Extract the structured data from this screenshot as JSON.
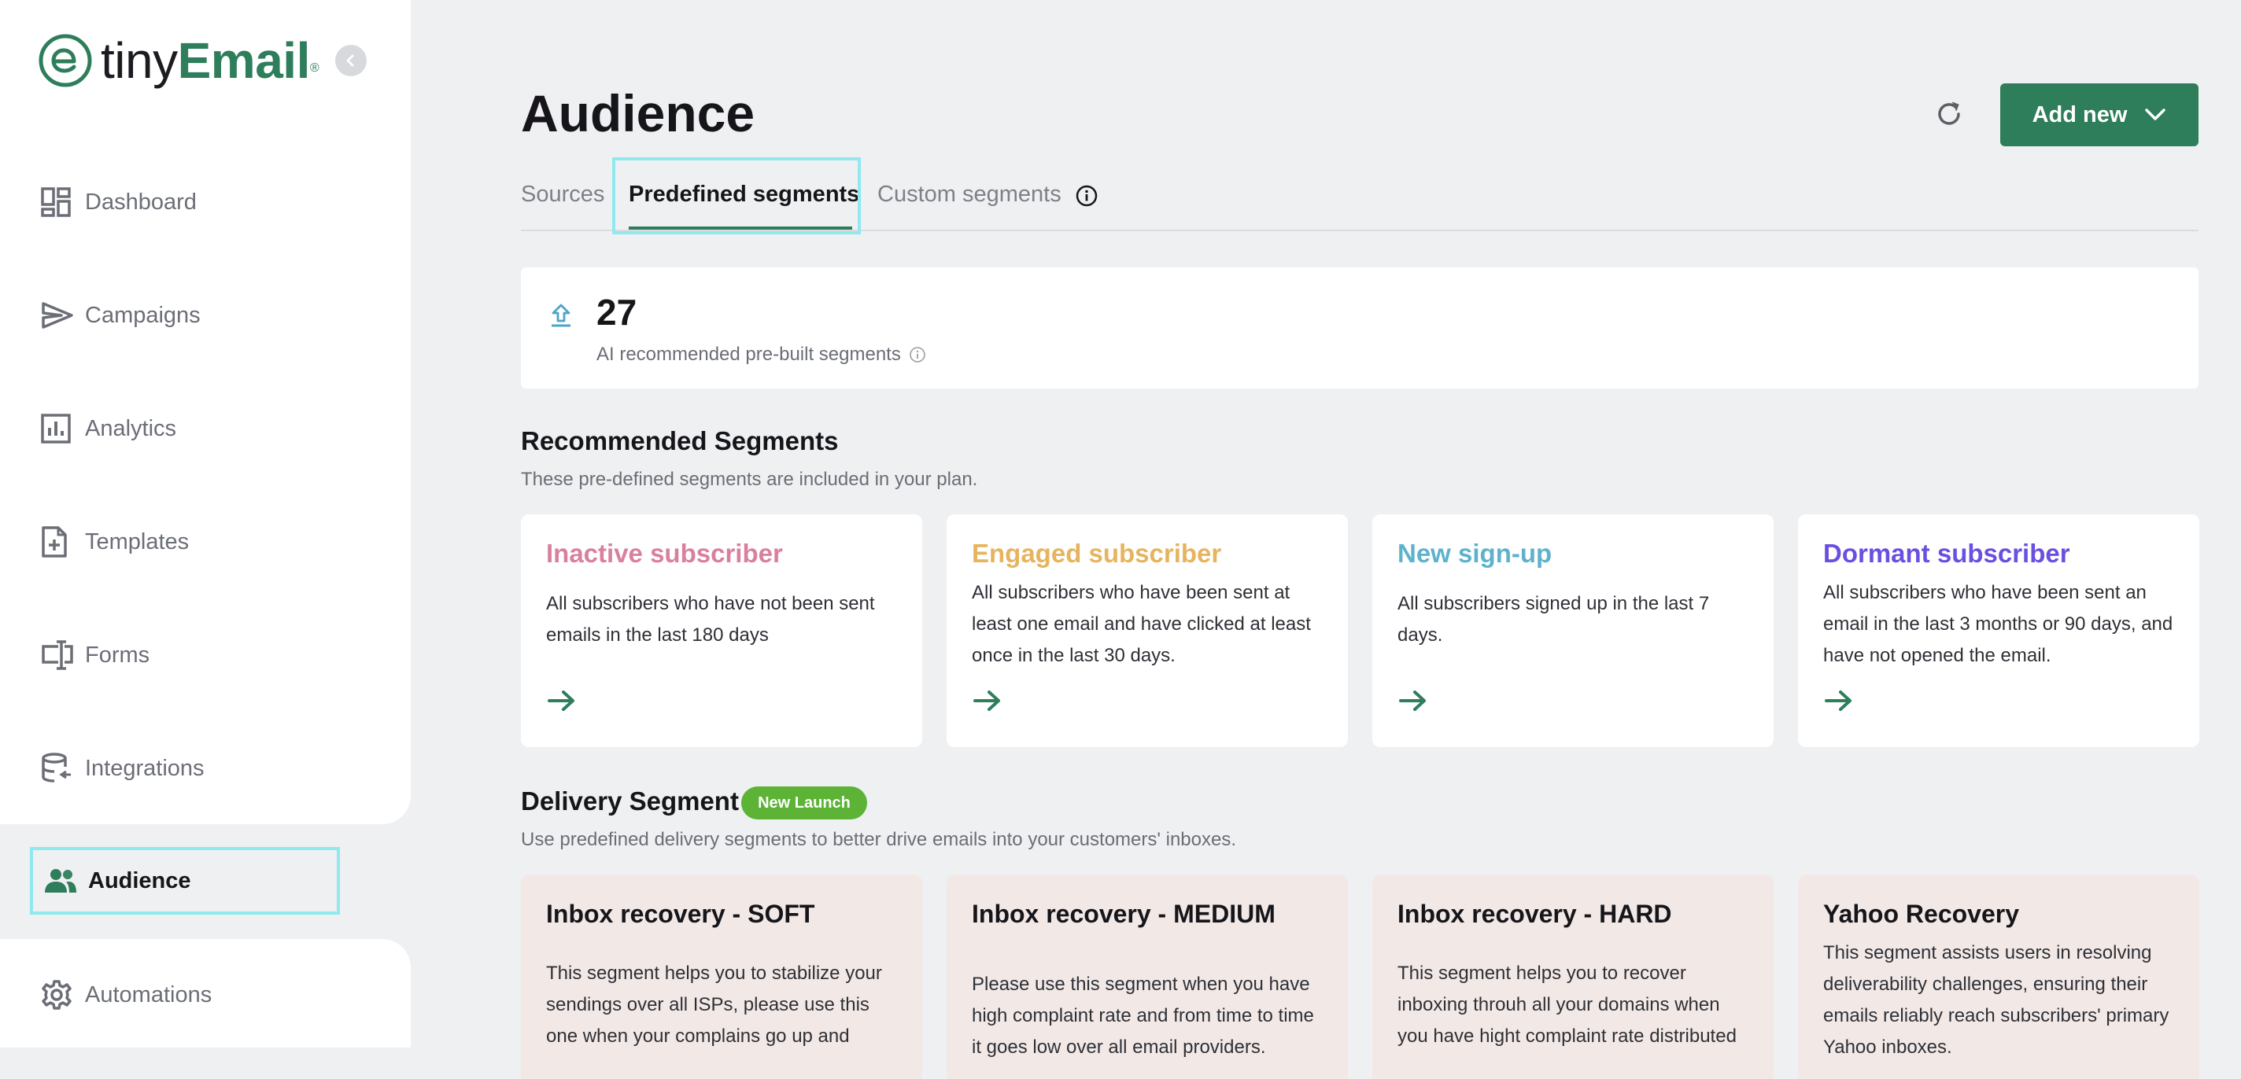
{
  "app": {
    "logo_text_tiny": "tiny",
    "logo_text_email": "Email",
    "logo_reg": "®"
  },
  "sidebar": {
    "items": [
      {
        "label": "Dashboard",
        "icon": "dashboard-icon"
      },
      {
        "label": "Campaigns",
        "icon": "send-icon"
      },
      {
        "label": "Analytics",
        "icon": "analytics-icon"
      },
      {
        "label": "Templates",
        "icon": "template-icon"
      },
      {
        "label": "Forms",
        "icon": "forms-icon"
      },
      {
        "label": "Integrations",
        "icon": "database-icon"
      },
      {
        "label": "Audience",
        "icon": "people-icon",
        "active": true
      },
      {
        "label": "Automations",
        "icon": "gear-icon"
      }
    ]
  },
  "header": {
    "title": "Audience",
    "add_new_label": "Add new"
  },
  "tabs": [
    {
      "label": "Sources"
    },
    {
      "label": "Predefined segments",
      "active": true
    },
    {
      "label": "Custom segments"
    }
  ],
  "stat": {
    "value": "27",
    "label": "AI recommended pre-built segments"
  },
  "recommended": {
    "title": "Recommended Segments",
    "description": "These pre-defined segments are included in your plan.",
    "cards": [
      {
        "title": "Inactive subscriber",
        "color": "#d9809f",
        "description": "All subscribers who have not been sent emails in the last 180 days"
      },
      {
        "title": "Engaged subscriber",
        "color": "#e6b45f",
        "description": "All subscribers who have been sent at least one email and have clicked at least once in the last 30 days."
      },
      {
        "title": "New sign-up",
        "color": "#5eb2cc",
        "description": "All subscribers signed up in the last 7 days."
      },
      {
        "title": "Dormant subscriber",
        "color": "#6a4fe0",
        "description": "All subscribers who have been sent an email in the last 3 months or 90 days, and have not opened the email."
      }
    ]
  },
  "delivery": {
    "title": "Delivery Segment",
    "badge": "New Launch",
    "description": "Use predefined delivery segments to better drive emails into your customers' inboxes.",
    "cards": [
      {
        "title": "Inbox recovery - SOFT",
        "description": "This segment helps you to stabilize your sendings over all ISPs, please use this one when your complains go up and"
      },
      {
        "title": "Inbox recovery - MEDIUM",
        "description": "Please use this segment when you have high complaint rate and from time to time it goes low over all email providers."
      },
      {
        "title": "Inbox recovery - HARD",
        "description": "This segment helps you to recover inboxing throuh all your domains when you have hight complaint rate distributed"
      },
      {
        "title": "Yahoo Recovery",
        "description": "This segment assists users in resolving deliverability challenges, ensuring their emails reliably reach subscribers' primary Yahoo inboxes."
      }
    ]
  },
  "colors": {
    "brand_green": "#2e7d5b",
    "badge_green": "#5cb335",
    "highlight": "#8fe9ef"
  }
}
